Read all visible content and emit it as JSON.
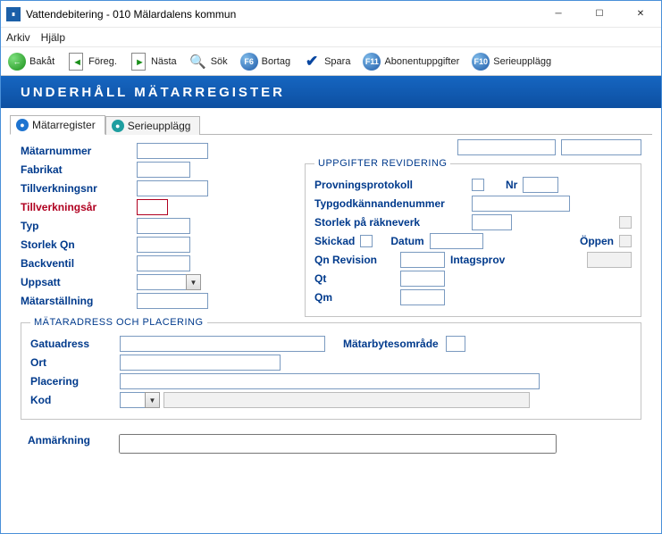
{
  "window": {
    "title": "Vattendebitering  -  010 Mälardalens kommun"
  },
  "menu": {
    "arkiv": "Arkiv",
    "hjalp": "Hjälp"
  },
  "toolbar": {
    "back": "Bakåt",
    "prev": "Föreg.",
    "next": "Nästa",
    "search": "Sök",
    "delete_key": "F6",
    "delete": "Bortag",
    "save": "Spara",
    "abonent_key": "F11",
    "abonent": "Abonentuppgifter",
    "serie_key": "F10",
    "serie": "Serieupplägg"
  },
  "banner": "UNDERHÅLL MÄTARREGISTER",
  "tabs": {
    "matarregister": "Mätarregister",
    "serieupplagg": "Serieupplägg"
  },
  "left": {
    "matarnummer": "Mätarnummer",
    "fabrikat": "Fabrikat",
    "tillverkningsnr": "Tillverkningsnr",
    "tillverkningsar": "Tillverkningsår",
    "typ": "Typ",
    "storlek_qn": "Storlek Qn",
    "backventil": "Backventil",
    "uppsatt": "Uppsatt",
    "matarstallning": "Mätarställning"
  },
  "rev": {
    "legend": "UPPGIFTER REVIDERING",
    "provningsprotokoll": "Provningsprotokoll",
    "nr": "Nr",
    "typgodkannande": "Typgodkännandenummer",
    "storlek_rakneverk": "Storlek på räkneverk",
    "skickad": "Skickad",
    "datum": "Datum",
    "oppen": "Öppen",
    "qn_revision": "Qn  Revision",
    "intagsprov": "Intagsprov",
    "qt": "Qt",
    "qm": "Qm"
  },
  "addr": {
    "legend": "MÄTARADRESS OCH PLACERING",
    "gatuadress": "Gatuadress",
    "matarbytesomrade": "Mätarbytesområde",
    "ort": "Ort",
    "placering": "Placering",
    "kod": "Kod"
  },
  "anmarkning": "Anmärkning"
}
